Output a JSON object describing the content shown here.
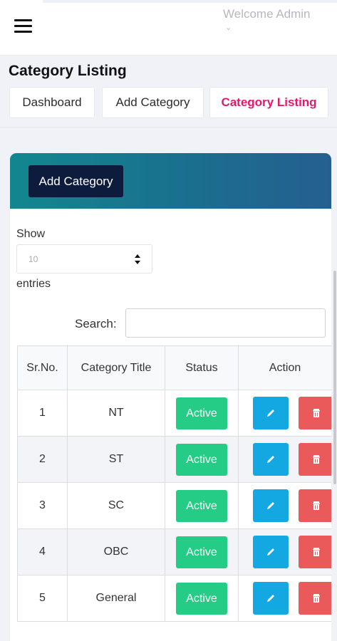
{
  "header": {
    "welcome_text": "Welcome Admin"
  },
  "page": {
    "title": "Category Listing"
  },
  "breadcrumbs": [
    {
      "label": "Dashboard",
      "active": false
    },
    {
      "label": "Add Category",
      "active": false
    },
    {
      "label": "Category Listing",
      "active": true
    }
  ],
  "card": {
    "add_button_label": "Add Category"
  },
  "table_controls": {
    "show_label": "Show",
    "entries_value": "10",
    "entries_label": "entries",
    "search_label": "Search:",
    "search_value": ""
  },
  "table": {
    "columns": [
      "Sr.No.",
      "Category Title",
      "Status",
      "Action"
    ],
    "rows": [
      {
        "sr": "1",
        "title": "NT",
        "status": "Active"
      },
      {
        "sr": "2",
        "title": "ST",
        "status": "Active"
      },
      {
        "sr": "3",
        "title": "SC",
        "status": "Active"
      },
      {
        "sr": "4",
        "title": "OBC",
        "status": "Active"
      },
      {
        "sr": "5",
        "title": "General",
        "status": "Active"
      }
    ]
  },
  "icons": {
    "menu": "hamburger-menu-icon",
    "caret": "chevron-down-icon",
    "edit": "pencil-icon",
    "delete": "trash-icon",
    "select": "sort-arrows-icon"
  },
  "colors": {
    "header_gradient_start": "#12878f",
    "header_gradient_end": "#255f90",
    "add_button": "#0d1b3d",
    "active_crumb": "#e5196b",
    "status_active": "#24cc85",
    "edit_button": "#14a8e3",
    "delete_button": "#ea5a5b"
  }
}
